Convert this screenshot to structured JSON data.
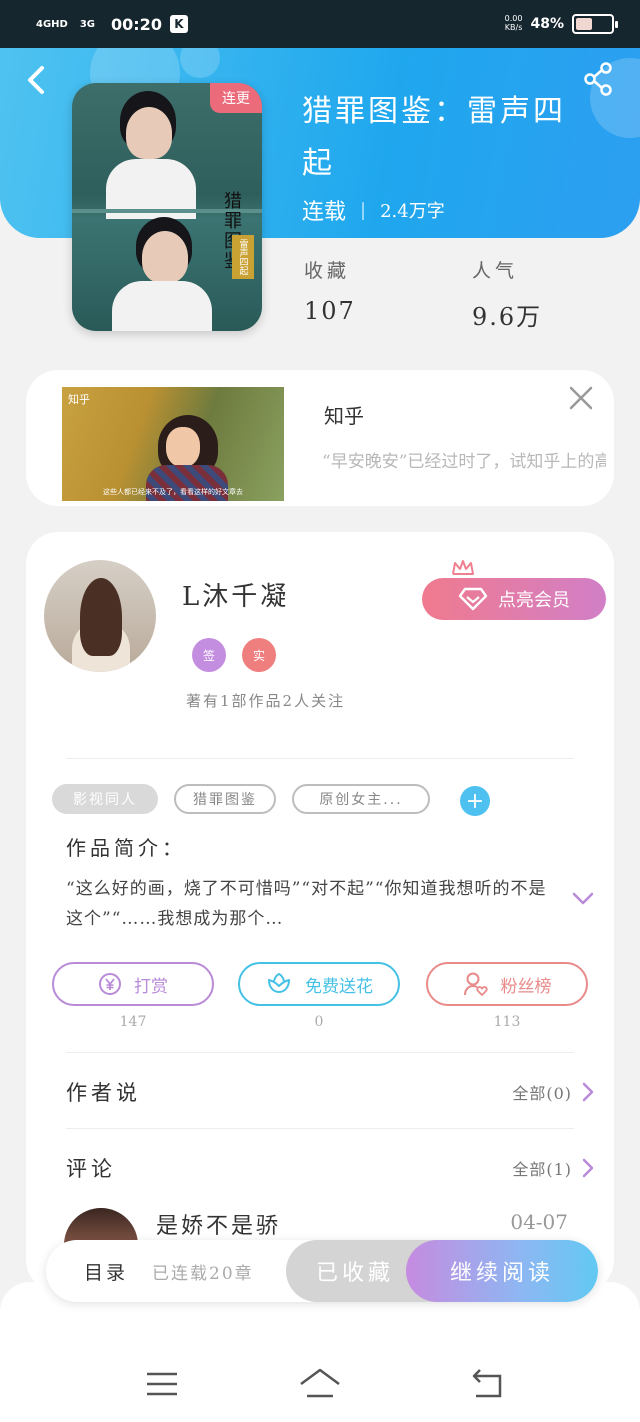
{
  "status_bar": {
    "signal1": "4GHD",
    "signal2": "3G",
    "time": "00:20",
    "app_badge": "K",
    "net_speed_value": "0.00",
    "net_speed_unit": "KB/s",
    "battery": "48%",
    "battery_level": 0.48
  },
  "book": {
    "cover_tag": "连更",
    "cover_calligraphy": "猎罪图鉴",
    "cover_seal": "雷声四起",
    "title": "猎罪图鉴：雷声四起",
    "status": "连载",
    "separator": "|",
    "word_count": "2.4万字"
  },
  "stats": {
    "favorites_label": "收藏",
    "favorites_value": "107",
    "popularity_label": "人气",
    "popularity_value": "9.6万"
  },
  "ad": {
    "logo": "知乎",
    "source": "知乎",
    "text": "“早安晚安”已经过时了，试知乎上的高情商文案，瞬",
    "caption": "这些人都已经来不及了，看看这样的好文章去"
  },
  "author": {
    "name": "L沐千凝",
    "vip_button": "点亮会员",
    "badge1": "签",
    "badge2": "实",
    "stats_text": "著有1部作品2人关注"
  },
  "tags": [
    "影视同人",
    "猎罪图鉴",
    "原创女主..."
  ],
  "intro": {
    "label": "作品简介：",
    "text": "“这么好的画，烧了不可惜吗”“对不起”“你知道我想听的不是这个”“……我想成为那个…"
  },
  "actions": [
    {
      "label": "打赏",
      "count": "147",
      "color": "#b98ad8"
    },
    {
      "label": "免费送花",
      "count": "0",
      "color": "#45c1e6"
    },
    {
      "label": "粉丝榜",
      "count": "113",
      "color": "#e88a8a"
    }
  ],
  "sections": {
    "author_says": "作者说",
    "author_says_all": "全部(0)",
    "comments": "评论",
    "comments_all": "全部(1)"
  },
  "comment": {
    "user": "是娇不是骄",
    "date": "04-07"
  },
  "bottom_bar": {
    "toc": "目录",
    "chapters": "已连载20章",
    "collected": "已收藏",
    "continue_reading": "继续阅读"
  },
  "colors": {
    "hero": "#1fa7ee",
    "accent_blue": "#4ec1f0",
    "vip_pink": "#f07a8e",
    "badge_purple": "#c48ee0",
    "badge_red": "#ef7f7f"
  }
}
